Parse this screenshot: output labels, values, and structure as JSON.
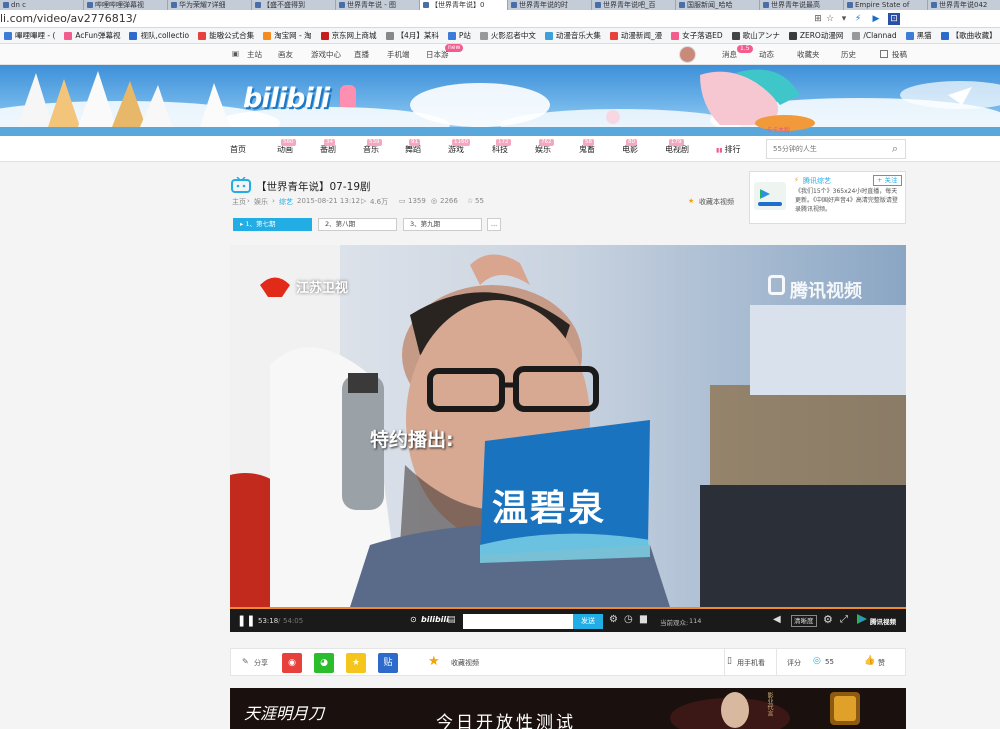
{
  "browser": {
    "tabs": [
      {
        "label": "dn c"
      },
      {
        "label": "哔哩哔哩弹幕视"
      },
      {
        "label": "华为荣耀7详细"
      },
      {
        "label": "【盛不盛得到"
      },
      {
        "label": "世界青年说 - 图"
      },
      {
        "label": "【世界青年说】0",
        "active": true
      },
      {
        "label": "世界青年说的时"
      },
      {
        "label": "世界青年说吧_百"
      },
      {
        "label": "国服新闻_哈哈"
      },
      {
        "label": "世界青年说最高"
      },
      {
        "label": "Empire State of"
      },
      {
        "label": "世界青年说042"
      },
      {
        "label": "(",
        "last": true
      }
    ],
    "url": "li.com/video/av2776813/",
    "bookmarks": [
      "嗶哩嗶哩 - (",
      "AcFun弹幕视",
      "视队,collectio",
      "能嗷公式合集",
      "淘宝网 - 淘",
      "京东网上商城",
      "【4月】某科",
      "P站",
      "火影忍者中文",
      "动漫音乐大集",
      "动漫新闻_漫",
      "女子落语ED",
      "歌山アンナ",
      "ZERO动漫网",
      "/Clannad",
      "黑猫",
      "【歌曲收藏】",
      "福利萌图"
    ]
  },
  "topnav": {
    "left": [
      "主站",
      "画友",
      "游戏中心",
      "直播",
      "手机端",
      "日本游"
    ],
    "new_badge": "new",
    "right": [
      "消息",
      "动态",
      "收藏夹",
      "历史",
      "投稿"
    ],
    "msg_count": "1.5"
  },
  "banner": {
    "logo": "bilibili",
    "caption": "卡卡木粉"
  },
  "mainnav": {
    "items": [
      {
        "label": "首页",
        "count": ""
      },
      {
        "label": "动画",
        "count": "560"
      },
      {
        "label": "番剧",
        "count": "34"
      },
      {
        "label": "音乐",
        "count": "539"
      },
      {
        "label": "舞蹈",
        "count": "91"
      },
      {
        "label": "游戏",
        "count": "1160"
      },
      {
        "label": "科技",
        "count": "172"
      },
      {
        "label": "娱乐",
        "count": "762"
      },
      {
        "label": "鬼畜",
        "count": "58"
      },
      {
        "label": "电影",
        "count": "80"
      },
      {
        "label": "电视剧",
        "count": "179"
      },
      {
        "label": "排行",
        "count": ""
      }
    ],
    "search_placeholder": "55分钟的人生"
  },
  "video": {
    "title": "【世界青年说】07-19剧",
    "breadcrumb": [
      "主页",
      "娱乐",
      "综艺"
    ],
    "date": "2015-08-21 13:12",
    "plays": "4.6万",
    "danmaku": "1359",
    "coins": "2266",
    "favs": "55",
    "fav_label": "收藏本视频",
    "episodes": [
      "1、第七期",
      "2、第八期",
      "3、第九期",
      "..."
    ]
  },
  "side_ad": {
    "source": "腾讯综艺",
    "follow": "+ 关注",
    "text": "《我们15个》365x24小时直播，每天更新。《中国好声音4》高清完整版请登录腾讯视频。"
  },
  "player": {
    "channel_logo": "江苏卫视",
    "watermark": "腾讯视频",
    "sponsor_caption": "特约播出:",
    "sponsor_brand": "温碧泉"
  },
  "controls": {
    "time": "53:18",
    "duration": "54:05",
    "progress": 0.985,
    "send": "发送",
    "viewers_label": "当前观众:",
    "viewers": "114",
    "quality": "清晰度",
    "source": "腾讯视频"
  },
  "share": {
    "share_label": "分享",
    "icon4": "贴",
    "collect": "收藏视频",
    "mobile": "用手机看",
    "rate_label": "评分",
    "rate": "55",
    "like": "赞"
  },
  "ad": {
    "brand": "天涯明月刀",
    "slogan": "今日开放性测试",
    "side": "影业代言"
  },
  "colors": {
    "accent": "#23ade5",
    "pink": "#f25d8e",
    "progress": "#ee8b2e"
  }
}
